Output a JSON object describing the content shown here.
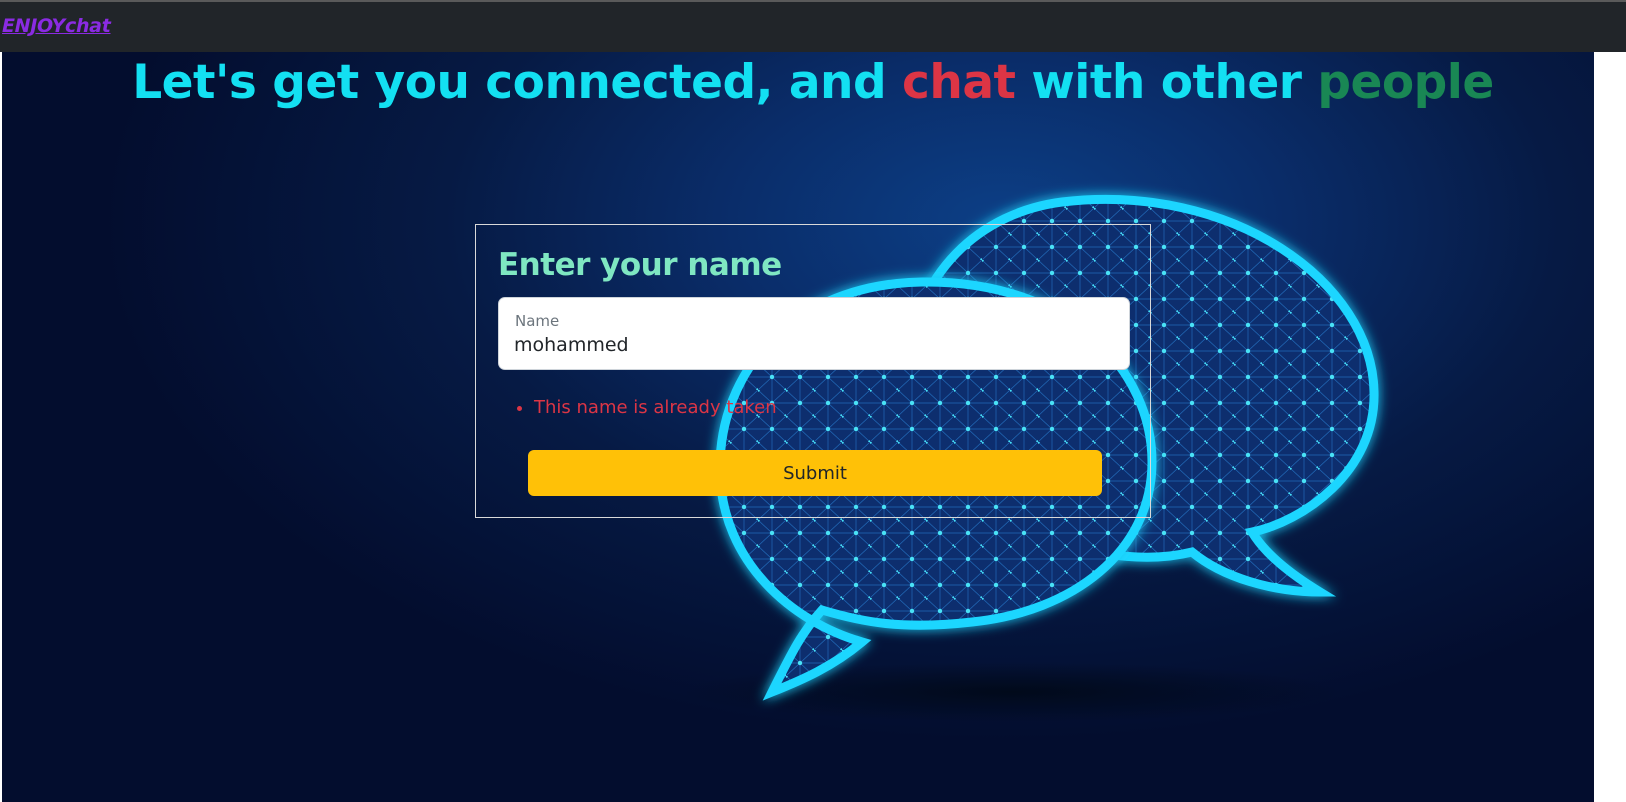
{
  "navbar": {
    "brand": "ENJOYchat"
  },
  "headline": {
    "part1": "Let's get you connected, and ",
    "chat": "chat",
    "part2": " with other ",
    "people": "people"
  },
  "form": {
    "title": "Enter your name",
    "name_label": "Name",
    "name_value": "mohammed",
    "errors": [
      "This name is already taken"
    ],
    "submit_label": "Submit"
  },
  "colors": {
    "navbar_bg": "#212529",
    "brand": "#8a2be2",
    "headline_cyan": "#13e0f2",
    "headline_red": "#dc3545",
    "headline_green": "#198754",
    "card_title": "#7fe7c2",
    "error": "#dc3545",
    "submit_bg": "#ffc107",
    "background_dark": "#030d2e"
  },
  "icons": {
    "background_art": "chat-bubbles-icon"
  }
}
